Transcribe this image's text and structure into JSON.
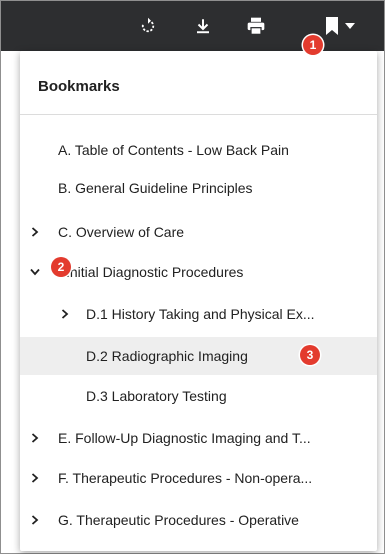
{
  "toolbar": {
    "icons": [
      "rotate-icon",
      "download-icon",
      "print-icon",
      "bookmark-icon",
      "dropdown-caret-icon"
    ],
    "bg_color": "#2d2e30"
  },
  "bookmarks": {
    "title": "Bookmarks",
    "items": [
      {
        "label": "A. Table of Contents - Low Back Pain",
        "level": 0,
        "expander": "none"
      },
      {
        "label": "B. General Guideline Principles",
        "level": 0,
        "expander": "none"
      },
      {
        "label": "C. Overview of Care",
        "level": 0,
        "expander": "collapsed"
      },
      {
        "label": "Initial Diagnostic Procedures",
        "level": 0,
        "expander": "expanded"
      },
      {
        "label": "D.1 History Taking and Physical Ex...",
        "level": 1,
        "expander": "collapsed"
      },
      {
        "label": "D.2 Radiographic Imaging",
        "level": 1,
        "expander": "none",
        "highlighted": true
      },
      {
        "label": "D.3 Laboratory Testing",
        "level": 1,
        "expander": "none"
      },
      {
        "label": "E. Follow-Up Diagnostic Imaging and T...",
        "level": 0,
        "expander": "collapsed"
      },
      {
        "label": "F. Therapeutic Procedures - Non-opera...",
        "level": 0,
        "expander": "collapsed"
      },
      {
        "label": "G. Therapeutic Procedures - Operative",
        "level": 0,
        "expander": "collapsed"
      }
    ]
  },
  "callouts": {
    "one": "1",
    "two": "2",
    "three": "3",
    "color": "#e33b2e"
  }
}
